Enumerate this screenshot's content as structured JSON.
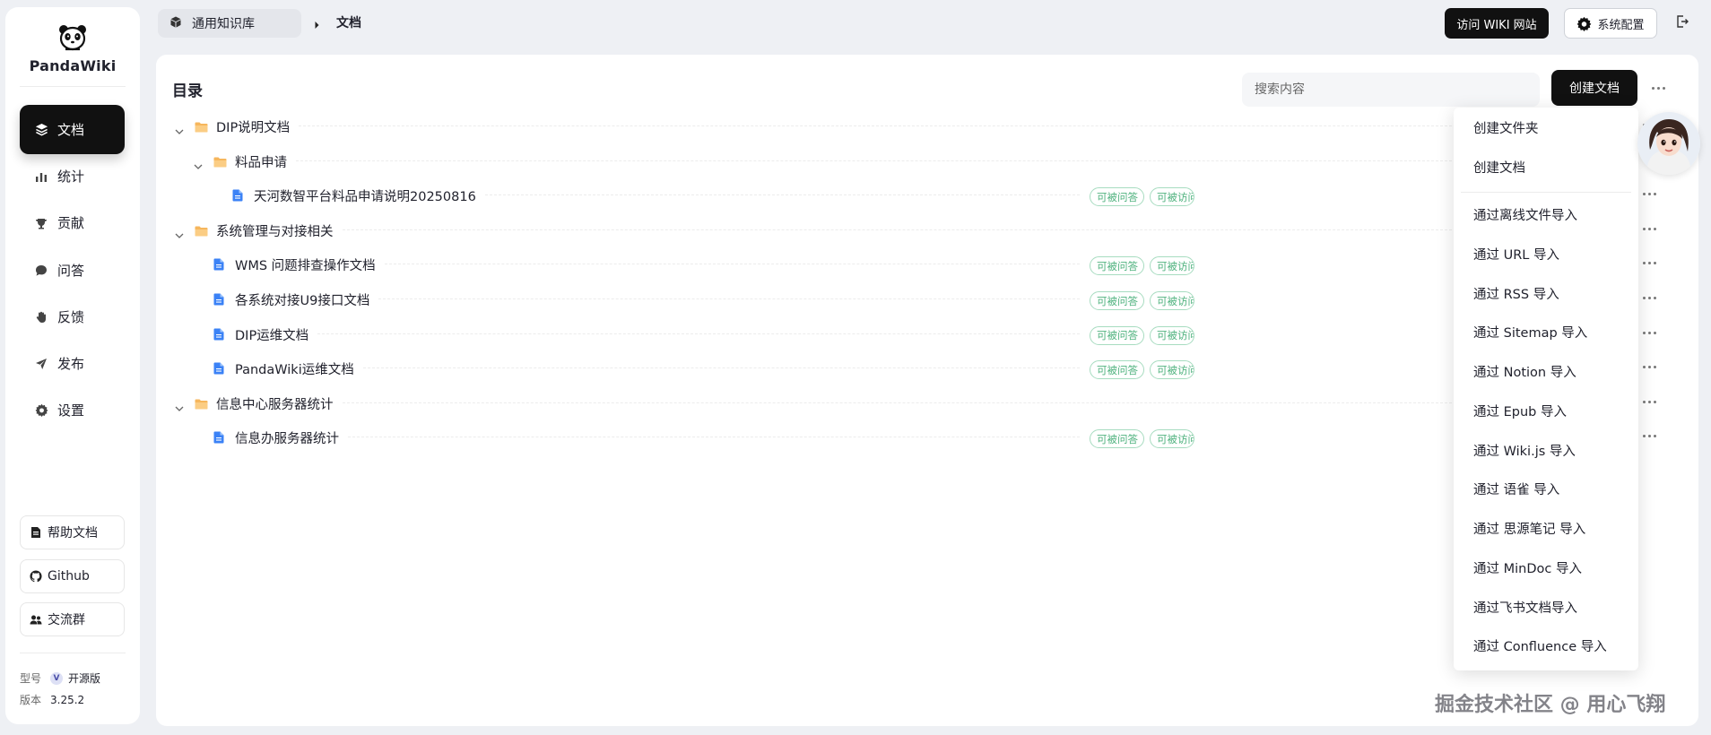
{
  "app": {
    "name": "PandaWiki"
  },
  "sidebar": {
    "nav": [
      {
        "label": "文档",
        "icon": "layers-icon",
        "active": true
      },
      {
        "label": "统计",
        "icon": "bar-chart-icon"
      },
      {
        "label": "贡献",
        "icon": "trophy-icon"
      },
      {
        "label": "问答",
        "icon": "chat-bubble-icon"
      },
      {
        "label": "反馈",
        "icon": "hand-icon"
      },
      {
        "label": "发布",
        "icon": "send-icon"
      },
      {
        "label": "设置",
        "icon": "gear-icon"
      }
    ],
    "links": [
      {
        "label": "帮助文档",
        "icon": "document-icon"
      },
      {
        "label": "Github",
        "icon": "github-icon"
      },
      {
        "label": "交流群",
        "icon": "group-icon"
      }
    ],
    "model_label": "型号",
    "model_badge": "V",
    "model_value": "开源版",
    "version_label": "版本",
    "version_value": "3.25.2"
  },
  "header": {
    "breadcrumb_root": "通用知识库",
    "breadcrumb_current": "文档",
    "visit_wiki": "访问 WIKI 网站",
    "system_config": "系统配置"
  },
  "panel": {
    "title": "目录",
    "search_placeholder": "搜索内容",
    "create_button": "创建文档"
  },
  "tree": [
    {
      "type": "folder",
      "label": "DIP说明文档",
      "level": 0
    },
    {
      "type": "folder",
      "label": "料品申请",
      "level": 1
    },
    {
      "type": "doc",
      "label": "天河数智平台料品申请说明20250816",
      "level": 2,
      "tags": [
        "可被问答",
        "可被访问"
      ]
    },
    {
      "type": "folder",
      "label": "系统管理与对接相关",
      "level": 0
    },
    {
      "type": "doc",
      "label": "WMS 问题排查操作文档",
      "level": 1,
      "tags": [
        "可被问答",
        "可被访问"
      ]
    },
    {
      "type": "doc",
      "label": "各系统对接U9接口文档",
      "level": 1,
      "tags": [
        "可被问答",
        "可被访问"
      ]
    },
    {
      "type": "doc",
      "label": "DIP运维文档",
      "level": 1,
      "tags": [
        "可被问答",
        "可被访问"
      ]
    },
    {
      "type": "doc",
      "label": "PandaWiki运维文档",
      "level": 1,
      "tags": [
        "可被问答",
        "可被访问"
      ]
    },
    {
      "type": "folder",
      "label": "信息中心服务器统计",
      "level": 0
    },
    {
      "type": "doc",
      "label": "信息办服务器统计",
      "level": 1,
      "tags": [
        "可被问答",
        "可被访问"
      ]
    }
  ],
  "menu": {
    "items": [
      "创建文件夹",
      "创建文档",
      "通过离线文件导入",
      "通过 URL 导入",
      "通过 RSS 导入",
      "通过 Sitemap 导入",
      "通过 Notion 导入",
      "通过 Epub 导入",
      "通过 Wiki.js 导入",
      "通过 语雀 导入",
      "通过 思源笔记 导入",
      "通过 MinDoc 导入",
      "通过飞书文档导入",
      "通过 Confluence 导入"
    ]
  },
  "watermark": "掘金技术社区 @ 用心飞翔",
  "colors": {
    "accent": "#111111",
    "tag_green": "#4fb27e",
    "folder": "#f6b65c",
    "doc": "#3b82f6"
  }
}
